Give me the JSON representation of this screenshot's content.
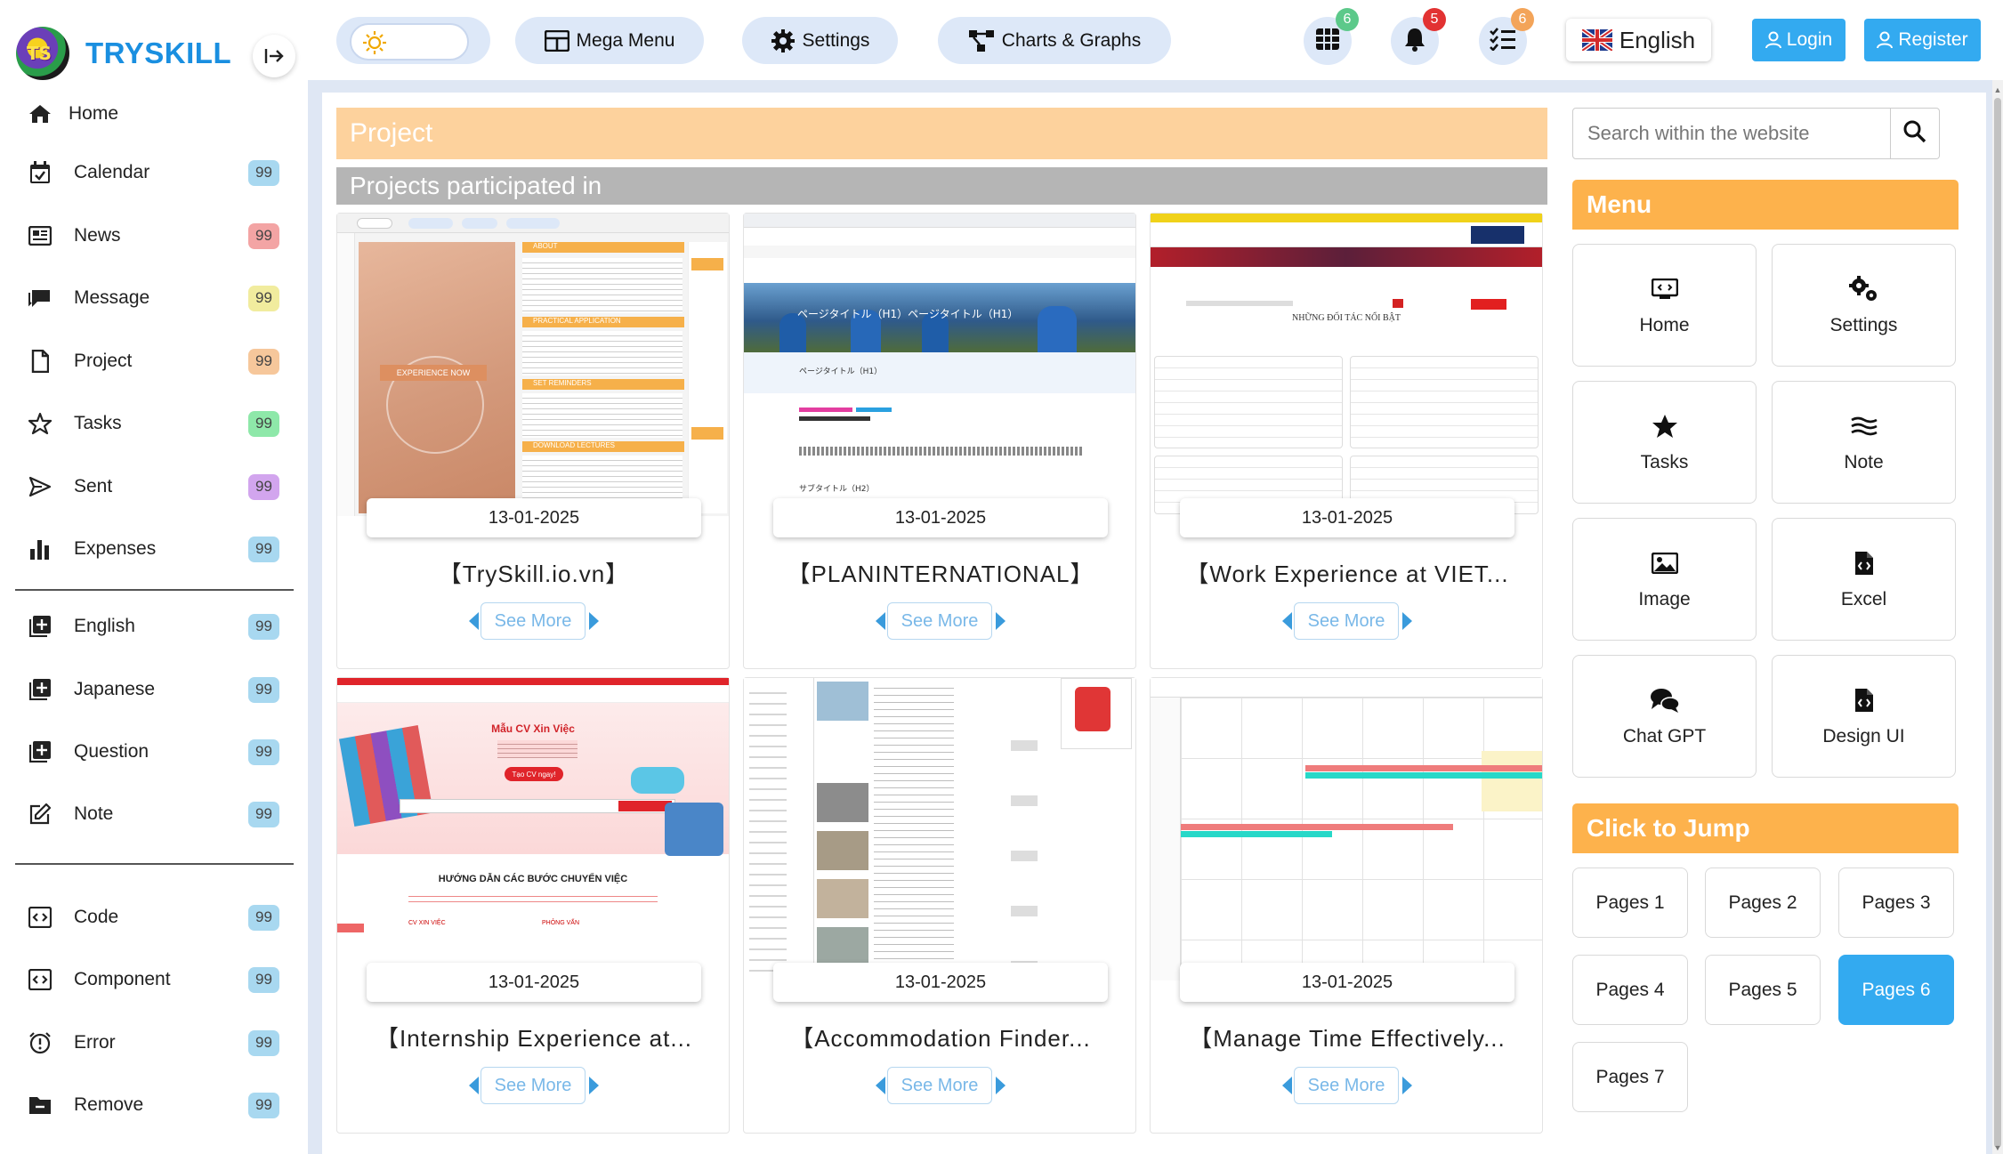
{
  "brand": {
    "name": "TRYSKILL"
  },
  "sidebar": {
    "items": [
      {
        "label": "Home",
        "icon": "home-icon"
      },
      {
        "label": "Calendar",
        "icon": "calendar-icon",
        "badge": "99",
        "badge_color": "#a8d8f0"
      },
      {
        "label": "News",
        "icon": "newspaper-icon",
        "badge": "99",
        "badge_color": "#f3a4a4"
      },
      {
        "label": "Message",
        "icon": "message-icon",
        "badge": "99",
        "badge_color": "#f1ec9e"
      },
      {
        "label": "Project",
        "icon": "file-icon",
        "badge": "99",
        "badge_color": "#f6c79b"
      },
      {
        "label": "Tasks",
        "icon": "star-icon",
        "badge": "99",
        "badge_color": "#8ee8a9"
      },
      {
        "label": "Sent",
        "icon": "send-icon",
        "badge": "99",
        "badge_color": "#d2a5ee"
      },
      {
        "label": "Expenses",
        "icon": "bar-chart-icon",
        "badge": "99",
        "badge_color": "#a8d8f0"
      },
      {
        "label": "English",
        "icon": "plus-box-icon",
        "badge": "99",
        "badge_color": "#a8d8f0"
      },
      {
        "label": "Japanese",
        "icon": "plus-box-icon",
        "badge": "99",
        "badge_color": "#a8d8f0"
      },
      {
        "label": "Question",
        "icon": "plus-box-icon",
        "badge": "99",
        "badge_color": "#a8d8f0"
      },
      {
        "label": "Note",
        "icon": "edit-icon",
        "badge": "99",
        "badge_color": "#a8d8f0"
      },
      {
        "label": "Code",
        "icon": "code-icon",
        "badge": "99",
        "badge_color": "#a8d8f0"
      },
      {
        "label": "Component",
        "icon": "code-icon",
        "badge": "99",
        "badge_color": "#a8d8f0"
      },
      {
        "label": "Error",
        "icon": "alarm-icon",
        "badge": "99",
        "badge_color": "#a8d8f0"
      },
      {
        "label": "Remove",
        "icon": "folder-minus-icon",
        "badge": "99",
        "badge_color": "#a8d8f0"
      }
    ]
  },
  "topbar": {
    "mega_menu": "Mega Menu",
    "settings": "Settings",
    "charts": "Charts & Graphs",
    "grid_count": "6",
    "bell_count": "5",
    "tasks_count": "6",
    "language": "English",
    "login": "Login",
    "register": "Register"
  },
  "main": {
    "page_title": "Project",
    "section_title": "Projects participated in",
    "see_more": "See More",
    "cards": [
      {
        "date": "13-01-2025",
        "title": "【TrySkill.io.vn】"
      },
      {
        "date": "13-01-2025",
        "title": "【PLANINTERNATIONAL】"
      },
      {
        "date": "13-01-2025",
        "title": "【Work Experience at VIET..."
      },
      {
        "date": "13-01-2025",
        "title": "【Internship Experience at..."
      },
      {
        "date": "13-01-2025",
        "title": "【Accommodation Finder..."
      },
      {
        "date": "13-01-2025",
        "title": "【Manage Time Effectively..."
      }
    ],
    "thumb_text": {
      "experience_now": "EXPERIENCE NOW",
      "about": "ABOUT",
      "practical": "PRACTICAL APPLICATION",
      "reminders": "SET REMINDERS",
      "lectures": "DOWNLOAD LECTURES",
      "jp_heading": "ページタイトル（H1）ページタイトル（H1）",
      "jp_h1": "ページタイトル（H1）",
      "jp_h2": "サブタイトル（H2）",
      "partners": "NHỮNG ĐỐI TÁC NỔI BẬT",
      "cv_title": "Mẫu CV Xin Việc",
      "cv_button": "Tạo CV ngay!",
      "cv_steps": "HƯỚNG DẪN CÁC BƯỚC CHUYỂN VIỆC",
      "cv_step1": "CV XIN VIỆC",
      "cv_step2": "PHỎNG VẤN"
    }
  },
  "right": {
    "search_placeholder": "Search within the website",
    "menu_title": "Menu",
    "menu": [
      {
        "label": "Home",
        "icon": "window-code-icon"
      },
      {
        "label": "Settings",
        "icon": "gears-icon"
      },
      {
        "label": "Tasks",
        "icon": "star-icon"
      },
      {
        "label": "Note",
        "icon": "lines-icon"
      },
      {
        "label": "Image",
        "icon": "image-icon"
      },
      {
        "label": "Excel",
        "icon": "file-code-icon"
      },
      {
        "label": "Chat GPT",
        "icon": "chat-icon"
      },
      {
        "label": "Design UI",
        "icon": "file-code-icon"
      }
    ],
    "jump_title": "Click to Jump",
    "pages": [
      "Pages 1",
      "Pages 2",
      "Pages 3",
      "Pages 4",
      "Pages 5",
      "Pages 6",
      "Pages 7"
    ],
    "active_page": "Pages 6"
  },
  "colors": {
    "accent": "#33aaf0",
    "orange": "#fdb24c",
    "peach": "#fdd29d",
    "brand": "#1a8fe0"
  }
}
